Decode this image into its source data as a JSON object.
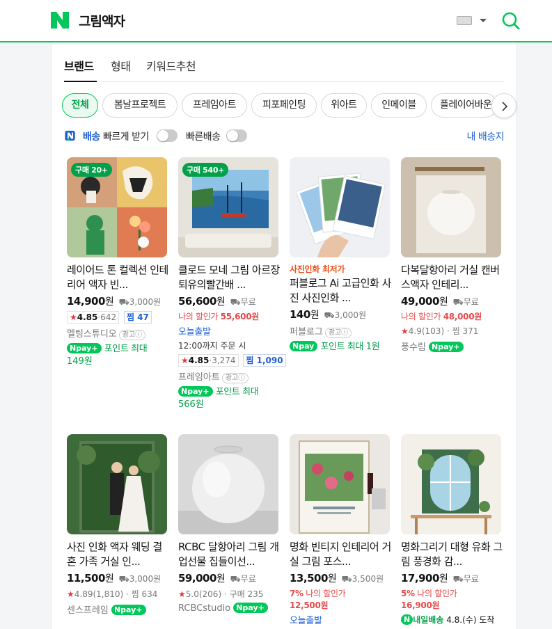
{
  "header": {
    "title": "그림액자"
  },
  "tabs": [
    {
      "label": "브랜드"
    },
    {
      "label": "형태"
    },
    {
      "label": "키워드추천"
    }
  ],
  "chips": [
    {
      "label": "전체"
    },
    {
      "label": "봄날프로젝트"
    },
    {
      "label": "프레임아트"
    },
    {
      "label": "피포페인팅"
    },
    {
      "label": "위아트"
    },
    {
      "label": "인메이블"
    },
    {
      "label": "플레이어바운"
    }
  ],
  "filters": {
    "npay_delivery": "배송",
    "fast_receive": "빠르게 받기",
    "fast_ship": "빠른배송",
    "my_delivery": "내 배송지"
  },
  "products": [
    {
      "badge": "구매 20+",
      "title": "레이어드 톤 컬렉션 인테리어 액자 빈...",
      "price": "14,900",
      "won": "원",
      "ship": "3,000원",
      "rating": "4.85",
      "rating_count": "642",
      "zzim": "찜 47",
      "mall": "멜팅스튜디오",
      "ad": "광고ⓘ",
      "pay_text": "포인트 최대",
      "pay_amount": "149원"
    },
    {
      "badge": "구매 540+",
      "title": "클로드 모네 그림 아르장퇴유의빨간배 ...",
      "price": "56,600",
      "won": "원",
      "ship": "무료",
      "discount_label": "나의 할인가",
      "discount_price": "55,600원",
      "today": "오늘출발",
      "order": "12:00까지 주문 시",
      "rating": "4.85",
      "rating_count": "3,274",
      "zzim": "찜 1,090",
      "mall": "프레임아트",
      "ad": "광고ⓘ",
      "pay_text": "포인트 최대",
      "pay_amount": "566원"
    },
    {
      "tag": "사진인화 최저가",
      "title": "퍼블로그 Ai 고급인화 사진 사진인화 ...",
      "price": "140",
      "won": "원",
      "ship": "3,000원",
      "mall": "퍼블로그",
      "ad": "광고ⓘ",
      "pay_text": "포인트 최대 1원"
    },
    {
      "title": "다복달항아리 거실 캔버스액자 인테리...",
      "price": "49,000",
      "won": "원",
      "ship": "무료",
      "discount_label": "나의 할인가",
      "discount_price": "48,000원",
      "rating": "4.9",
      "rating_count": "(103)",
      "zzim": "찜 371",
      "mall": "풍수림"
    },
    {
      "title": "사진 인화 액자 웨딩 결혼 가족 거실 인...",
      "price": "11,500",
      "won": "원",
      "ship": "3,000원",
      "rating": "4.89",
      "rating_count": "(1,810)",
      "zzim": "찜 634",
      "mall": "센스프레임"
    },
    {
      "title": "RCBC 달항아리 그림 개업선물 집들이선...",
      "price": "59,000",
      "won": "원",
      "ship": "무료",
      "rating": "5.0",
      "rating_count": "(206)",
      "buy": "구매 235",
      "mall": "RCBCstudio"
    },
    {
      "title": "명화 빈티지 인테리어 거실 그림 포스...",
      "price": "13,500",
      "won": "원",
      "ship": "3,500원",
      "discount_pct": "7%",
      "discount_label": "나의 할인가",
      "discount_price": "12,500원",
      "today": "오늘출발"
    },
    {
      "title": "명화그리기 대형 유화 그림 풍경화 감...",
      "price": "17,900",
      "won": "원",
      "ship": "무료",
      "discount_pct": "5%",
      "discount_label": "나의 할인가",
      "discount_price": "16,900원",
      "tomorrow": "내일배송",
      "tomorrow_date": "4.8.(수) 도착"
    }
  ],
  "npay_label": "pay",
  "colors": {
    "brand_green": "#03c75a",
    "discount_red": "#e84a4a",
    "link_blue": "#1e5fd6"
  }
}
